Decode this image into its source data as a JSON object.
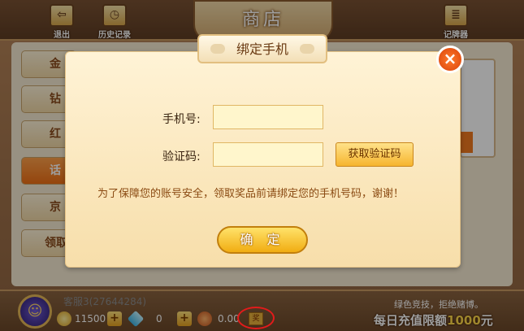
{
  "topbar": {
    "exit_label": "退出",
    "history_label": "历史记录",
    "store_title": "商店",
    "tracker_label": "记牌器"
  },
  "sidebar": {
    "items": [
      {
        "label": "金"
      },
      {
        "label": "钻"
      },
      {
        "label": "红"
      },
      {
        "label": "话"
      },
      {
        "label": "京"
      },
      {
        "label": "领取"
      }
    ],
    "active_index": 3
  },
  "modal": {
    "title": "绑定手机",
    "phone_label": "手机号:",
    "phone_value": "",
    "code_label": "验证码:",
    "code_value": "",
    "get_code_label": "获取验证码",
    "notice": "为了保障您的账号安全，领取奖品前请绑定您的手机号码，谢谢！",
    "confirm_label": "确 定",
    "close_icon": "×"
  },
  "bottombar": {
    "username": "客服3(27644284)",
    "gold": "11500",
    "diamonds": "0",
    "prize_value": "0.00",
    "prize_chip": "奖",
    "slogan": "绿色竞技，拒绝赌博。",
    "promo_prefix": "每日充值限额",
    "promo_amount": "1000",
    "promo_suffix": "元"
  },
  "colors": {
    "accent_orange": "#f07016",
    "highlight_red": "#e31b1b",
    "gold": "#f6b52e"
  }
}
